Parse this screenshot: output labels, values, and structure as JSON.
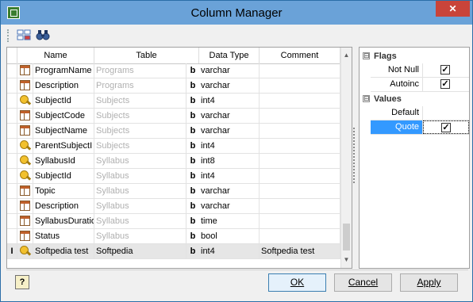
{
  "window": {
    "title": "Column Manager",
    "close_glyph": "✕"
  },
  "toolbar": {
    "buttons": [
      {
        "icon": "columns-grid-icon"
      },
      {
        "icon": "binoculars-icon"
      }
    ]
  },
  "grid": {
    "headers": [
      "Name",
      "Table",
      "Data Type",
      "Comment"
    ],
    "rows": [
      {
        "icon": "table-icon",
        "name": "ProgramName",
        "table": "Programs",
        "bold": "b",
        "type": "varchar",
        "comment": ""
      },
      {
        "icon": "table-icon",
        "name": "Description",
        "table": "Programs",
        "bold": "b",
        "type": "varchar",
        "comment": ""
      },
      {
        "icon": "key-icon",
        "name": "SubjectId",
        "table": "Subjects",
        "bold": "b",
        "type": "int4",
        "comment": ""
      },
      {
        "icon": "table-icon",
        "name": "SubjectCode",
        "table": "Subjects",
        "bold": "b",
        "type": "varchar",
        "comment": ""
      },
      {
        "icon": "table-icon",
        "name": "SubjectName",
        "table": "Subjects",
        "bold": "b",
        "type": "varchar",
        "comment": ""
      },
      {
        "icon": "key-icon",
        "name": "ParentSubjectI",
        "table": "Subjects",
        "bold": "b",
        "type": "int4",
        "comment": ""
      },
      {
        "icon": "key-icon",
        "name": "SyllabusId",
        "table": "Syllabus",
        "bold": "b",
        "type": "int8",
        "comment": ""
      },
      {
        "icon": "key-icon",
        "name": "SubjectId",
        "table": "Syllabus",
        "bold": "b",
        "type": "int4",
        "comment": ""
      },
      {
        "icon": "table-icon",
        "name": "Topic",
        "table": "Syllabus",
        "bold": "b",
        "type": "varchar",
        "comment": ""
      },
      {
        "icon": "table-icon",
        "name": "Description",
        "table": "Syllabus",
        "bold": "b",
        "type": "varchar",
        "comment": ""
      },
      {
        "icon": "table-icon",
        "name": "SyllabusDuratio",
        "table": "Syllabus",
        "bold": "b",
        "type": "time",
        "comment": ""
      },
      {
        "icon": "table-icon",
        "name": "Status",
        "table": "Syllabus",
        "bold": "b",
        "type": "bool",
        "comment": ""
      },
      {
        "icon": "key-icon",
        "name": "Softpedia test",
        "table": "Softpedia",
        "bold": "b",
        "type": "int4",
        "comment": "Softpedia test",
        "indicator": "I",
        "selected": true
      }
    ]
  },
  "properties": {
    "groups": [
      {
        "title": "Flags",
        "toggle": "⊟",
        "items": [
          {
            "label": "Not Null",
            "checked": "✓"
          },
          {
            "label": "Autoinc",
            "checked": "✓"
          }
        ]
      },
      {
        "title": "Values",
        "toggle": "⊟",
        "items": [
          {
            "label": "Default",
            "checked": ""
          },
          {
            "label": "Quote",
            "checked": "✓",
            "selected": true
          }
        ]
      }
    ]
  },
  "footer": {
    "help_label": "?",
    "ok_label": "OK",
    "cancel_label": "Cancel",
    "apply_label": "Apply"
  },
  "colors": {
    "selection": "#3399ff",
    "titlebar": "#6aa2d8",
    "close": "#c9443a"
  }
}
